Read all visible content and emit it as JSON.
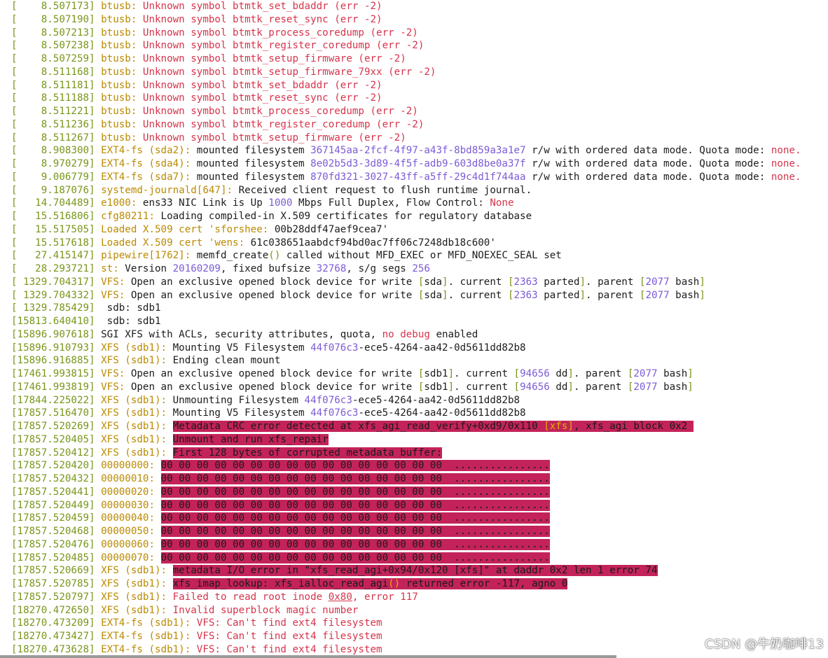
{
  "watermark": "CSDN @牛奶咖啡13",
  "lines": [
    [
      [
        "[    8.507173] ",
        "g"
      ],
      [
        "btusb: ",
        "o"
      ],
      [
        "Unknown symbol btmtk_set_bdaddr (err -2)",
        "r"
      ]
    ],
    [
      [
        "[    8.507190] ",
        "g"
      ],
      [
        "btusb: ",
        "o"
      ],
      [
        "Unknown symbol btmtk_reset_sync (err -2)",
        "r"
      ]
    ],
    [
      [
        "[    8.507213] ",
        "g"
      ],
      [
        "btusb: ",
        "o"
      ],
      [
        "Unknown symbol btmtk_process_coredump (err -2)",
        "r"
      ]
    ],
    [
      [
        "[    8.507238] ",
        "g"
      ],
      [
        "btusb: ",
        "o"
      ],
      [
        "Unknown symbol btmtk_register_coredump (err -2)",
        "r"
      ]
    ],
    [
      [
        "[    8.507259] ",
        "g"
      ],
      [
        "btusb: ",
        "o"
      ],
      [
        "Unknown symbol btmtk_setup_firmware (err -2)",
        "r"
      ]
    ],
    [
      [
        "[    8.511168] ",
        "g"
      ],
      [
        "btusb: ",
        "o"
      ],
      [
        "Unknown symbol btmtk_setup_firmware_79xx (err -2)",
        "r"
      ]
    ],
    [
      [
        "[    8.511181] ",
        "g"
      ],
      [
        "btusb: ",
        "o"
      ],
      [
        "Unknown symbol btmtk_set_bdaddr (err -2)",
        "r"
      ]
    ],
    [
      [
        "[    8.511188] ",
        "g"
      ],
      [
        "btusb: ",
        "o"
      ],
      [
        "Unknown symbol btmtk_reset_sync (err -2)",
        "r"
      ]
    ],
    [
      [
        "[    8.511221] ",
        "g"
      ],
      [
        "btusb: ",
        "o"
      ],
      [
        "Unknown symbol btmtk_process_coredump (err -2)",
        "r"
      ]
    ],
    [
      [
        "[    8.511236] ",
        "g"
      ],
      [
        "btusb: ",
        "o"
      ],
      [
        "Unknown symbol btmtk_register_coredump (err -2)",
        "r"
      ]
    ],
    [
      [
        "[    8.511267] ",
        "g"
      ],
      [
        "btusb: ",
        "o"
      ],
      [
        "Unknown symbol btmtk_setup_firmware (err -2)",
        "r"
      ]
    ],
    [
      [
        "[    8.908300] ",
        "g"
      ],
      [
        "EXT4-fs (sda2): ",
        "o"
      ],
      [
        "mounted filesystem ",
        ""
      ],
      [
        "367145aa-2fcf-4f97-a43f-8bd859a3a1e7",
        "p"
      ],
      [
        " r/w with ordered data mode. Quota mode: ",
        ""
      ],
      [
        "none.",
        "r"
      ]
    ],
    [
      [
        "[    8.970279] ",
        "g"
      ],
      [
        "EXT4-fs (sda4): ",
        "o"
      ],
      [
        "mounted filesystem ",
        ""
      ],
      [
        "8e02b5d3-3d89-4f5f-adb9-603d8be0a37f",
        "p"
      ],
      [
        " r/w with ordered data mode. Quota mode: ",
        ""
      ],
      [
        "none.",
        "r"
      ]
    ],
    [
      [
        "[    9.006779] ",
        "g"
      ],
      [
        "EXT4-fs (sda7): ",
        "o"
      ],
      [
        "mounted filesystem ",
        ""
      ],
      [
        "870fd321-3027-43ff-a5ff-29c4d1f744aa",
        "p"
      ],
      [
        " r/w with ordered data mode. Quota mode: ",
        ""
      ],
      [
        "none.",
        "r"
      ]
    ],
    [
      [
        "[    9.187076] ",
        "g"
      ],
      [
        "systemd-journald[647]: ",
        "o"
      ],
      [
        "Received client request to flush runtime journal.",
        ""
      ]
    ],
    [
      [
        "[   14.704489] ",
        "g"
      ],
      [
        "e1000: ",
        "o"
      ],
      [
        "ens33 NIC Link is Up ",
        ""
      ],
      [
        "1000",
        "p"
      ],
      [
        " Mbps Full Duplex, Flow Control: ",
        ""
      ],
      [
        "None",
        "r"
      ]
    ],
    [
      [
        "[   15.516806] ",
        "g"
      ],
      [
        "cfg80211: ",
        "o"
      ],
      [
        "Loading compiled-in X.509 certificates for regulatory database",
        ""
      ]
    ],
    [
      [
        "[   15.517505] ",
        "g"
      ],
      [
        "Loaded X.509 cert 'sforshee: ",
        "o"
      ],
      [
        "00b28ddf47aef9cea7'",
        ""
      ]
    ],
    [
      [
        "[   15.517618] ",
        "g"
      ],
      [
        "Loaded X.509 cert 'wens: ",
        "o"
      ],
      [
        "61c038651aabdcf94bd0ac7ff06c7248db18c600'",
        ""
      ]
    ],
    [
      [
        "[   27.415147] ",
        "g"
      ],
      [
        "pipewire[1762]: ",
        "o"
      ],
      [
        "memfd_create",
        ""
      ],
      [
        "()",
        "g"
      ],
      [
        " called without MFD_EXEC or MFD_NOEXEC_SEAL set",
        ""
      ]
    ],
    [
      [
        "[   28.293721] ",
        "g"
      ],
      [
        "st: ",
        "o"
      ],
      [
        "Version ",
        ""
      ],
      [
        "20160209",
        "p"
      ],
      [
        ", fixed bufsize ",
        ""
      ],
      [
        "32768",
        "p"
      ],
      [
        ", s/g segs ",
        ""
      ],
      [
        "256",
        "p"
      ]
    ],
    [
      [
        "[ 1329.704317] ",
        "g"
      ],
      [
        "VFS: ",
        "o"
      ],
      [
        "Open an exclusive opened block device for write ",
        ""
      ],
      [
        "[",
        "g"
      ],
      [
        "sda",
        ""
      ],
      [
        "]",
        "g"
      ],
      [
        ". current ",
        ""
      ],
      [
        "[",
        "g"
      ],
      [
        "2363",
        "p"
      ],
      [
        " parted",
        ""
      ],
      [
        "]",
        "g"
      ],
      [
        ". parent ",
        ""
      ],
      [
        "[",
        "g"
      ],
      [
        "2077",
        "p"
      ],
      [
        " bash",
        ""
      ],
      [
        "]",
        "g"
      ]
    ],
    [
      [
        "[ 1329.704332] ",
        "g"
      ],
      [
        "VFS: ",
        "o"
      ],
      [
        "Open an exclusive opened block device for write ",
        ""
      ],
      [
        "[",
        "g"
      ],
      [
        "sda",
        ""
      ],
      [
        "]",
        "g"
      ],
      [
        ". current ",
        ""
      ],
      [
        "[",
        "g"
      ],
      [
        "2363",
        "p"
      ],
      [
        " parted",
        ""
      ],
      [
        "]",
        "g"
      ],
      [
        ". parent ",
        ""
      ],
      [
        "[",
        "g"
      ],
      [
        "2077",
        "p"
      ],
      [
        " bash",
        ""
      ],
      [
        "]",
        "g"
      ]
    ],
    [
      [
        "[ 1329.785429] ",
        "g"
      ],
      [
        " sdb: sdb1",
        ""
      ]
    ],
    [
      [
        "[15813.640410] ",
        "g"
      ],
      [
        " sdb: sdb1",
        ""
      ]
    ],
    [
      [
        "[15896.907618] ",
        "g"
      ],
      [
        "SGI XFS with ACLs, security attributes, quota, ",
        ""
      ],
      [
        "no debug",
        "r"
      ],
      [
        " enabled",
        ""
      ]
    ],
    [
      [
        "[15896.910793] ",
        "g"
      ],
      [
        "XFS (sdb1): ",
        "o"
      ],
      [
        "Mounting V5 Filesystem ",
        ""
      ],
      [
        "44f076c3",
        "p"
      ],
      [
        "-ece5-4264-aa42-0d5611dd82b8",
        ""
      ]
    ],
    [
      [
        "[15896.916885] ",
        "g"
      ],
      [
        "XFS (sdb1): ",
        "o"
      ],
      [
        "Ending clean mount",
        ""
      ]
    ],
    [
      [
        "[17461.993815] ",
        "g"
      ],
      [
        "VFS: ",
        "o"
      ],
      [
        "Open an exclusive opened block device for write ",
        ""
      ],
      [
        "[",
        "g"
      ],
      [
        "sdb1",
        ""
      ],
      [
        "]",
        "g"
      ],
      [
        ". current ",
        ""
      ],
      [
        "[",
        "g"
      ],
      [
        "94656",
        "p"
      ],
      [
        " dd",
        ""
      ],
      [
        "]",
        "g"
      ],
      [
        ". parent ",
        ""
      ],
      [
        "[",
        "g"
      ],
      [
        "2077",
        "p"
      ],
      [
        " bash",
        ""
      ],
      [
        "]",
        "g"
      ]
    ],
    [
      [
        "[17461.993819] ",
        "g"
      ],
      [
        "VFS: ",
        "o"
      ],
      [
        "Open an exclusive opened block device for write ",
        ""
      ],
      [
        "[",
        "g"
      ],
      [
        "sdb1",
        ""
      ],
      [
        "]",
        "g"
      ],
      [
        ". current ",
        ""
      ],
      [
        "[",
        "g"
      ],
      [
        "94656",
        "p"
      ],
      [
        " dd",
        ""
      ],
      [
        "]",
        "g"
      ],
      [
        ". parent ",
        ""
      ],
      [
        "[",
        "g"
      ],
      [
        "2077",
        "p"
      ],
      [
        " bash",
        ""
      ],
      [
        "]",
        "g"
      ]
    ],
    [
      [
        "[17844.225022] ",
        "g"
      ],
      [
        "XFS (sdb1): ",
        "o"
      ],
      [
        "Unmounting Filesystem ",
        ""
      ],
      [
        "44f076c3",
        "p"
      ],
      [
        "-ece5-4264-aa42-0d5611dd82b8",
        ""
      ]
    ],
    [
      [
        "[17857.516470] ",
        "g"
      ],
      [
        "XFS (sdb1): ",
        "o"
      ],
      [
        "Mounting V5 Filesystem ",
        ""
      ],
      [
        "44f076c3",
        "p"
      ],
      [
        "-ece5-4264-aa42-0d5611dd82b8",
        ""
      ]
    ],
    [
      [
        "[17857.520269] ",
        "g"
      ],
      [
        "XFS (sdb1): ",
        "o"
      ],
      [
        "Metadata CRC error detected at xfs_agi_read_verify+0xd9/0x110 ",
        "hl"
      ],
      [
        "[xfs]",
        "hlo"
      ],
      [
        ", xfs_agi block 0x2 ",
        "hl"
      ]
    ],
    [
      [
        "[17857.520405] ",
        "g"
      ],
      [
        "XFS (sdb1): ",
        "o"
      ],
      [
        "Unmount and run xfs_repair",
        "hl"
      ]
    ],
    [
      [
        "[17857.520412] ",
        "g"
      ],
      [
        "XFS (sdb1): ",
        "o"
      ],
      [
        "First 128 bytes of corrupted metadata buffer:",
        "hl"
      ]
    ],
    [
      [
        "[17857.520420] ",
        "g"
      ],
      [
        "00000000: ",
        "o"
      ],
      [
        "00 00 00 00 00 00 00 00 00 00 00 00 00 00 00 00  ................",
        "hl"
      ]
    ],
    [
      [
        "[17857.520432] ",
        "g"
      ],
      [
        "00000010: ",
        "o"
      ],
      [
        "00 00 00 00 00 00 00 00 00 00 00 00 00 00 00 00  ................",
        "hl"
      ]
    ],
    [
      [
        "[17857.520441] ",
        "g"
      ],
      [
        "00000020: ",
        "o"
      ],
      [
        "00 00 00 00 00 00 00 00 00 00 00 00 00 00 00 00  ................",
        "hl"
      ]
    ],
    [
      [
        "[17857.520449] ",
        "g"
      ],
      [
        "00000030: ",
        "o"
      ],
      [
        "00 00 00 00 00 00 00 00 00 00 00 00 00 00 00 00  ................",
        "hl"
      ]
    ],
    [
      [
        "[17857.520459] ",
        "g"
      ],
      [
        "00000040: ",
        "o"
      ],
      [
        "00 00 00 00 00 00 00 00 00 00 00 00 00 00 00 00  ................",
        "hl"
      ]
    ],
    [
      [
        "[17857.520468] ",
        "g"
      ],
      [
        "00000050: ",
        "o"
      ],
      [
        "00 00 00 00 00 00 00 00 00 00 00 00 00 00 00 00  ................",
        "hl"
      ]
    ],
    [
      [
        "[17857.520476] ",
        "g"
      ],
      [
        "00000060: ",
        "o"
      ],
      [
        "00 00 00 00 00 00 00 00 00 00 00 00 00 00 00 00  ................",
        "hl"
      ]
    ],
    [
      [
        "[17857.520485] ",
        "g"
      ],
      [
        "00000070: ",
        "o"
      ],
      [
        "00 00 00 00 00 00 00 00 00 00 00 00 00 00 00 00  ................",
        "hl"
      ]
    ],
    [
      [
        "[17857.520669] ",
        "g"
      ],
      [
        "XFS (sdb1): ",
        "o"
      ],
      [
        "metadata I/O error in \"xfs_read_agi+0x94/0x120 [xfs]\" at daddr 0x2 len 1 error 74",
        "hl"
      ]
    ],
    [
      [
        "[17857.520785] ",
        "g"
      ],
      [
        "XFS (sdb1): ",
        "o"
      ],
      [
        "xfs_imap_lookup: xfs_ialloc_read_agi",
        "hl"
      ],
      [
        "()",
        "hlo"
      ],
      [
        " returned error -117, agno 0",
        "hl"
      ]
    ],
    [
      [
        "[17857.520797] ",
        "g"
      ],
      [
        "XFS (sdb1): ",
        "o"
      ],
      [
        "Failed to read root inode ",
        "r"
      ],
      [
        "0x80",
        "ru"
      ],
      [
        ", error 117",
        "r"
      ]
    ],
    [
      [
        "[18270.472650] ",
        "g"
      ],
      [
        "XFS (sdb1): ",
        "o"
      ],
      [
        "Invalid superblock magic number",
        "r"
      ]
    ],
    [
      [
        "[18270.473209] ",
        "g"
      ],
      [
        "EXT4-fs (sdb1): ",
        "o"
      ],
      [
        "VFS: Can't find ext4 filesystem",
        "r"
      ]
    ],
    [
      [
        "[18270.473427] ",
        "g"
      ],
      [
        "EXT4-fs (sdb1): ",
        "o"
      ],
      [
        "VFS: Can't find ext4 filesystem",
        "r"
      ]
    ],
    [
      [
        "[18270.473628] ",
        "g"
      ],
      [
        "EXT4-fs (sdb1): ",
        "o"
      ],
      [
        "VFS: Can't find ext4 filesystem",
        "r"
      ]
    ]
  ]
}
